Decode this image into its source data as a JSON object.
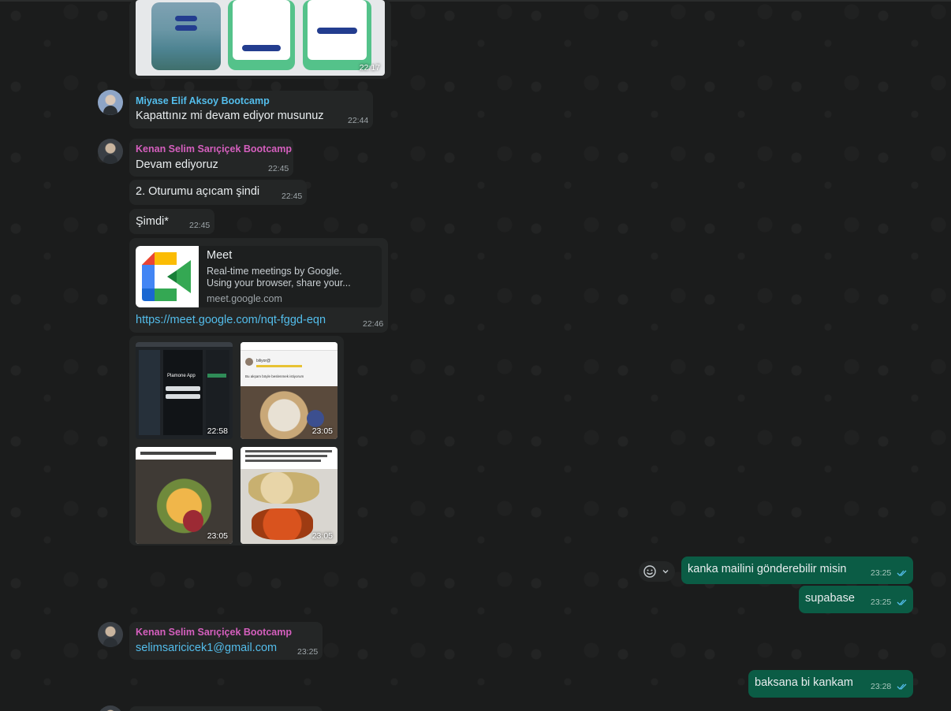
{
  "messages": {
    "top_image_time": "22:17",
    "m1": {
      "sender": "Miyase Elif Aksoy Bootcamp",
      "sender_color": "#53bdeb",
      "text": "Kapattınız mi devam ediyor musunuz",
      "time": "22:44"
    },
    "m2": {
      "sender": "Kenan Selim Sarıçiçek Bootcamp",
      "sender_color": "#d55fbe",
      "text": "Devam ediyoruz",
      "time": "22:45"
    },
    "m3": {
      "text": "2. Oturumu açıcam şindi",
      "time": "22:45"
    },
    "m4": {
      "text": "Şimdi*",
      "time": "22:45"
    },
    "m5": {
      "preview_title": "Meet",
      "preview_desc_line1": "Real-time meetings by Google.",
      "preview_desc_line2": "Using your browser, share your...",
      "preview_domain": "meet.google.com",
      "link": "https://meet.google.com/nqt-fggd-eqn",
      "time": "22:46"
    },
    "album": {
      "times": [
        "22:58",
        "23:05",
        "23:05",
        "23:05"
      ],
      "tile1_app_name": "Plamone App",
      "tile2_caption": "Bu akşam böyle beslenmek istiyorum",
      "tile2_name": "biliyor@"
    },
    "o1": {
      "text": "kanka mailini gönderebilir misin",
      "time": "23:25"
    },
    "o2": {
      "text": "supabase",
      "time": "23:25"
    },
    "m6": {
      "sender": "Kenan Selim Sarıçiçek Bootcamp",
      "sender_color": "#d55fbe",
      "text": "selimsaricicek1@gmail.com",
      "time": "23:25"
    },
    "o3": {
      "text": "baksana bi kankam",
      "time": "23:28"
    }
  },
  "colors": {
    "outgoing_bubble": "#0b5c45",
    "incoming_bubble": "#242626",
    "read_ticks": "#53bdeb"
  },
  "icons": [
    "emoji-icon",
    "chevron-down-icon",
    "double-check-icon",
    "google-meet-logo"
  ]
}
